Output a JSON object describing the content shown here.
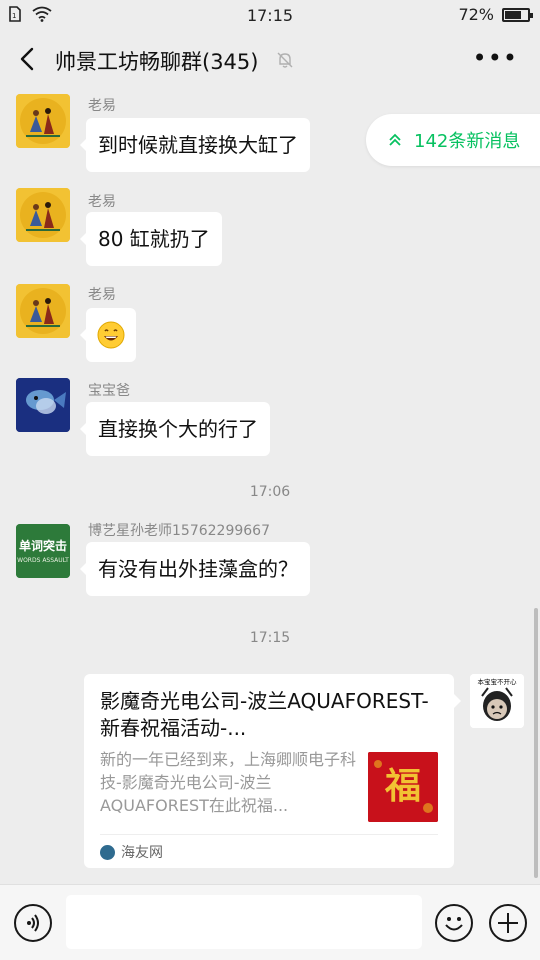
{
  "status_bar": {
    "time": "17:15",
    "battery": "72%",
    "battery_level": 0.72
  },
  "header": {
    "title": "帅景工坊畅聊群(345)",
    "more_label": "•••"
  },
  "new_messages": {
    "label": "142条新消息",
    "icon": "double-chevron-up-icon"
  },
  "messages": [
    {
      "sender": "老易",
      "text": "到时候就直接换大缸了"
    },
    {
      "sender": "老易",
      "text": "80 缸就扔了"
    },
    {
      "sender": "老易",
      "text": "😄"
    },
    {
      "sender": "宝宝爸",
      "text": "直接换个大的行了"
    },
    {
      "sender": "博艺星孙老师15762299667",
      "text": "有没有出外挂藻盒的？"
    }
  ],
  "timestamps": [
    "17:06",
    "17:15"
  ],
  "avatar_text": {
    "boyi_line1": "单词突击",
    "boyi_line2": "WORDS ASSAULT",
    "self_caption": "本宝宝不开心"
  },
  "link_card": {
    "title": "影魔奇光电公司-波兰AQUAFOREST-新春祝福活动-...",
    "description": "新的一年已经到来，上海卿顺电子科技-影魔奇光电公司-波兰AQUAFOREST在此祝福...",
    "thumb_char": "福",
    "source": "海友网"
  },
  "input": {
    "placeholder": ""
  },
  "colors": {
    "accent": "#07c160",
    "background": "#ededed",
    "bubble": "#ffffff",
    "thumb_red": "#c8111b",
    "gold": "#f2c233"
  }
}
